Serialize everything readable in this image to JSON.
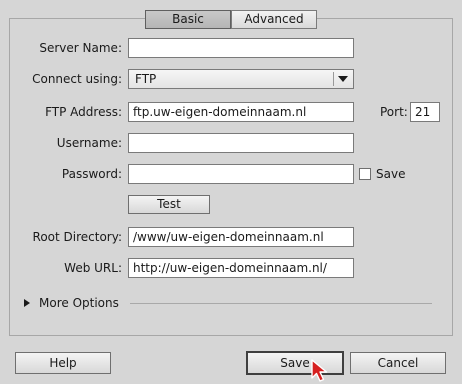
{
  "tabs": [
    {
      "label": "Basic",
      "active": true
    },
    {
      "label": "Advanced",
      "active": false
    }
  ],
  "form": {
    "server_name": {
      "label": "Server Name:",
      "value": ""
    },
    "connect_using": {
      "label": "Connect using:",
      "value": "FTP"
    },
    "ftp_address": {
      "label": "FTP Address:",
      "value": "ftp.uw-eigen-domeinnaam.nl"
    },
    "port": {
      "label": "Port:",
      "value": "21"
    },
    "username": {
      "label": "Username:",
      "value": ""
    },
    "password": {
      "label": "Password:",
      "value": ""
    },
    "save_password": {
      "label": "Save",
      "checked": false
    },
    "test_button": {
      "label": "Test"
    },
    "root_directory": {
      "label": "Root Directory:",
      "value": "/www/uw-eigen-domeinnaam.nl"
    },
    "web_url": {
      "label": "Web URL:",
      "value": "http://uw-eigen-domeinnaam.nl/"
    },
    "more_options": {
      "label": "More Options"
    }
  },
  "footer": {
    "help_label": "Help",
    "save_label": "Save",
    "cancel_label": "Cancel"
  },
  "colors": {
    "background": "#d6d6d6",
    "active_tab": "#b9b9b9",
    "cursor_accent": "#d62020"
  }
}
